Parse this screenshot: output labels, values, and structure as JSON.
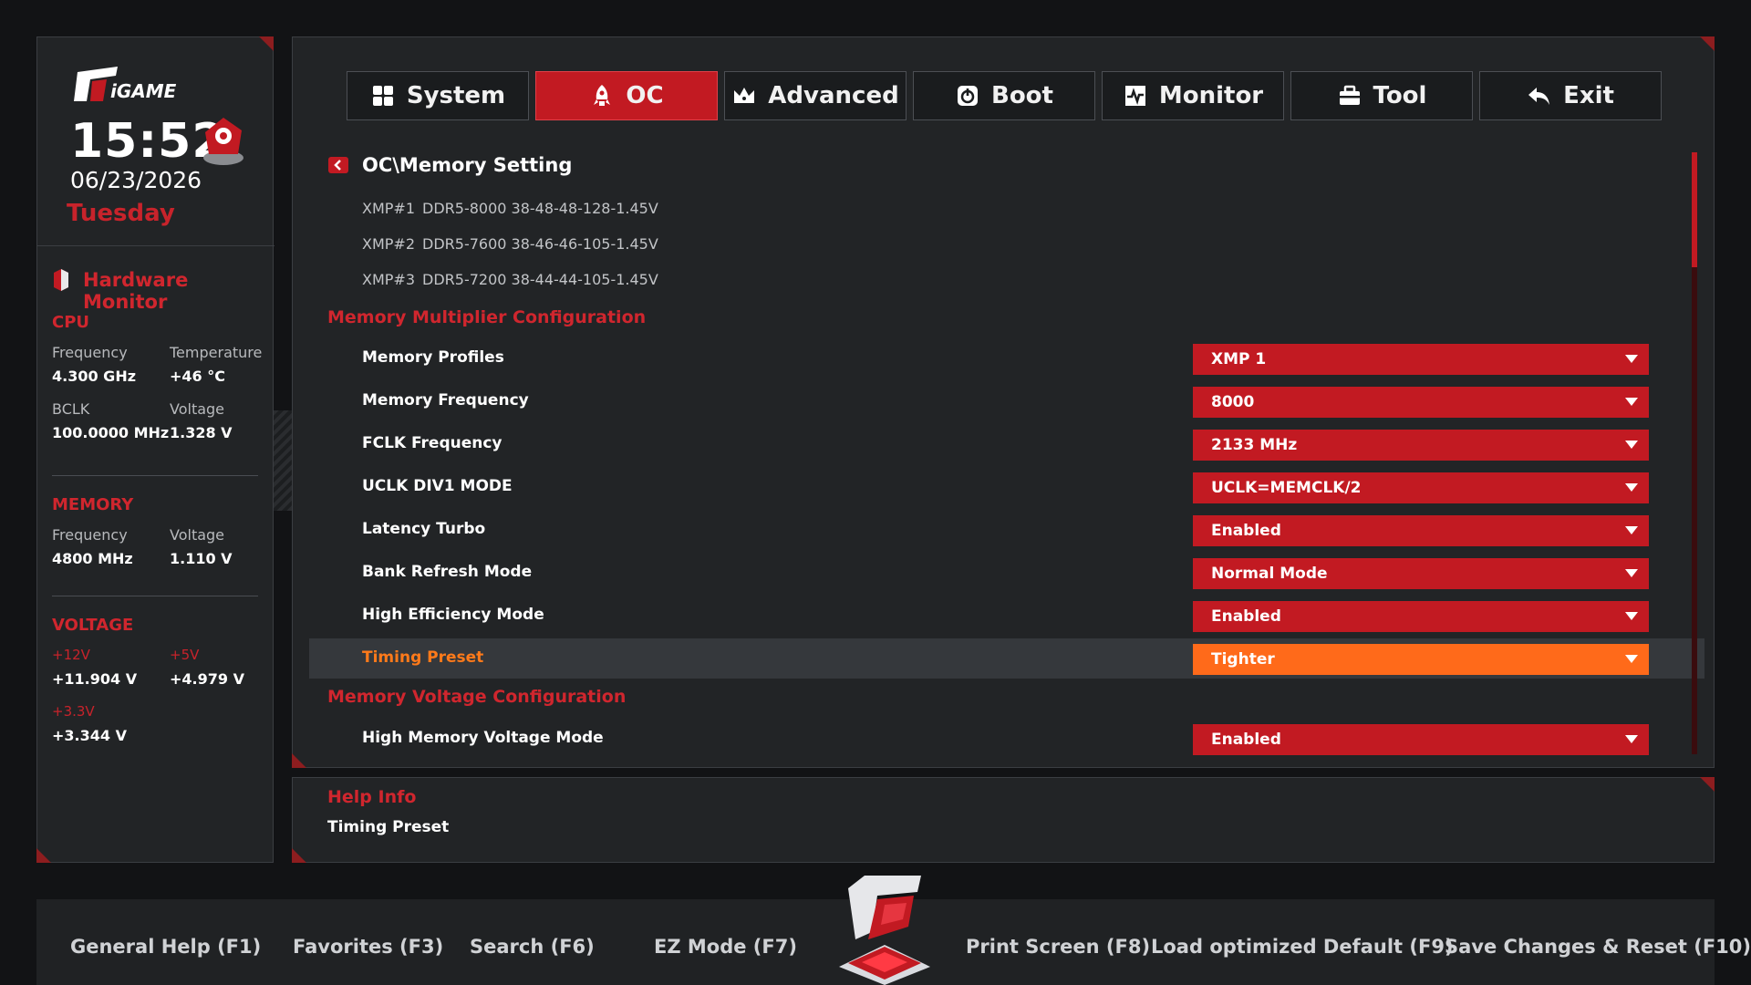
{
  "clock": {
    "time": "15:52",
    "date": "06/23/2026",
    "day": "Tuesday"
  },
  "hardware_monitor": {
    "title": "Hardware Monitor",
    "cpu": {
      "title": "CPU",
      "freq_label": "Frequency",
      "freq": "4.300 GHz",
      "temp_label": "Temperature",
      "temp": "+46 °C",
      "bclk_label": "BCLK",
      "bclk": "100.0000 MHz",
      "volt_label": "Voltage",
      "volt": "1.328 V"
    },
    "memory": {
      "title": "MEMORY",
      "freq_label": "Frequency",
      "freq": "4800 MHz",
      "volt_label": "Voltage",
      "volt": "1.110 V"
    },
    "voltage": {
      "title": "VOLTAGE",
      "v12_label": "+12V",
      "v12": "+11.904 V",
      "v5_label": "+5V",
      "v5": "+4.979 V",
      "v33_label": "+3.3V",
      "v33": "+3.344 V"
    }
  },
  "tabs": [
    {
      "label": "System",
      "icon": "grid-icon"
    },
    {
      "label": "OC",
      "icon": "rocket-icon",
      "active": true
    },
    {
      "label": "Advanced",
      "icon": "crown-icon"
    },
    {
      "label": "Boot",
      "icon": "power-icon"
    },
    {
      "label": "Monitor",
      "icon": "pulse-icon"
    },
    {
      "label": "Tool",
      "icon": "toolbox-icon"
    },
    {
      "label": "Exit",
      "icon": "back-arrow-icon"
    }
  ],
  "path": "OC\\Memory Setting",
  "xmp": [
    {
      "tag": "XMP#1",
      "value": "DDR5-8000 38-48-48-128-1.45V"
    },
    {
      "tag": "XMP#2",
      "value": "DDR5-7600 38-46-46-105-1.45V"
    },
    {
      "tag": "XMP#3",
      "value": "DDR5-7200 38-44-44-105-1.45V"
    }
  ],
  "sections": {
    "multiplier": "Memory Multiplier Configuration",
    "voltage": "Memory Voltage Configuration"
  },
  "settings": [
    {
      "label": "Memory Profiles",
      "value": "XMP 1"
    },
    {
      "label": "Memory Frequency",
      "value": "8000"
    },
    {
      "label": "FCLK Frequency",
      "value": "2133 MHz"
    },
    {
      "label": "UCLK DIV1 MODE",
      "value": "UCLK=MEMCLK/2"
    },
    {
      "label": "Latency Turbo",
      "value": "Enabled"
    },
    {
      "label": "Bank Refresh Mode",
      "value": "Normal Mode"
    },
    {
      "label": "High Efficiency Mode",
      "value": "Enabled"
    },
    {
      "label": "Timing Preset",
      "value": "Tighter",
      "selected": true
    },
    {
      "label": "High Memory Voltage Mode",
      "value": "Enabled"
    }
  ],
  "help": {
    "title": "Help Info",
    "text": "Timing Preset"
  },
  "footer": {
    "f1": "General Help (F1)",
    "f3": "Favorites (F3)",
    "f6": "Search (F6)",
    "f7": "EZ Mode (F7)",
    "f8": "Print Screen (F8)",
    "f9": "Load optimized Default (F9)",
    "f10": "Save Changes & Reset (F10)"
  },
  "colors": {
    "accent": "#c21a22",
    "selected": "#ff6a1a",
    "panel": "#222426",
    "background": "#121315"
  }
}
